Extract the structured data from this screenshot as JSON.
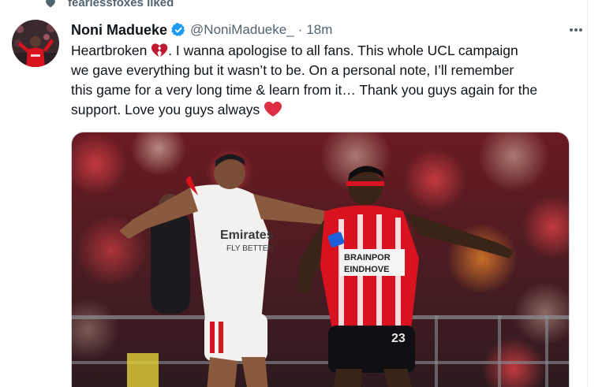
{
  "social_context": {
    "icon": "heart-icon",
    "text": "fearlessfoxes liked"
  },
  "tweet": {
    "display_name": "Noni Madueke",
    "verified_icon": "verified-badge-icon",
    "handle": "@NoniMadueke_",
    "separator": "·",
    "timestamp": "18m",
    "more_icon": "more-horizontal-icon",
    "text_lines": [
      "Heartbroken",
      ". I wanna apologise to all fans. This whole UCL campaign",
      "we gave everything but it wasn’t to be. On a personal note, I’ll remember",
      "this game for a very long time & learn from it… Thank you guys again for the",
      "support. Love you guys always"
    ],
    "emojis": [
      "broken-heart-emoji",
      "red-heart-emoji"
    ]
  },
  "media": {
    "alt": "Football match photo",
    "jersey_left": {
      "sponsor_line1": "Emirates",
      "sponsor_line2": "FLY BETTER"
    },
    "jersey_right": {
      "sponsor_line1": "BRAINPOR",
      "sponsor_line2": "EINDHOVE",
      "number": "23"
    }
  },
  "colors": {
    "verified_blue": "#1d9bf0",
    "secondary_text": "#536471",
    "psv_red": "#d8121f",
    "heart_red": "#e0245e"
  }
}
